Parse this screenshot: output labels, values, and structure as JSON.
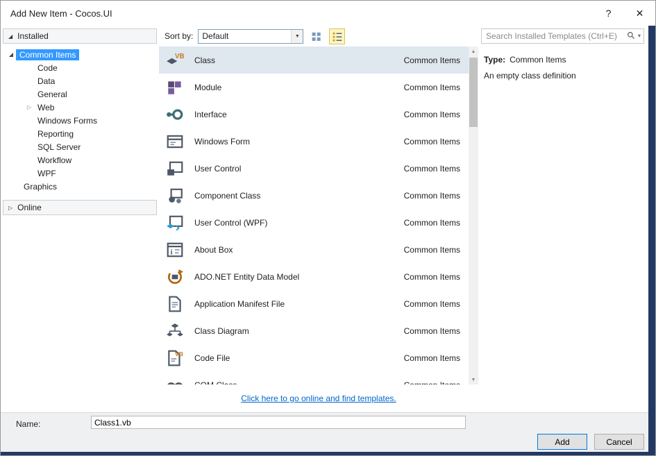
{
  "titlebar": {
    "title": "Add New Item - Cocos.UI",
    "help": "?",
    "close": "✕"
  },
  "icons": {
    "expanded": "◢",
    "collapsed": "▷",
    "combo_arrow": "▼",
    "scroll_up": "▲",
    "scroll_down": "▼",
    "search_caret": "▾"
  },
  "sidebar": {
    "installed_header": "Installed",
    "online_header": "Online",
    "tree": [
      {
        "label": "Common Items",
        "selected": true
      },
      {
        "label": "Code"
      },
      {
        "label": "Data"
      },
      {
        "label": "General"
      },
      {
        "label": "Web"
      },
      {
        "label": "Windows Forms"
      },
      {
        "label": "Reporting"
      },
      {
        "label": "SQL Server"
      },
      {
        "label": "Workflow"
      },
      {
        "label": "WPF"
      },
      {
        "label": "Graphics"
      }
    ]
  },
  "toolbar": {
    "sort_label": "Sort by:",
    "sort_value": "Default"
  },
  "search": {
    "placeholder": "Search Installed Templates (Ctrl+E)"
  },
  "templates": {
    "items": [
      {
        "name": "Class",
        "category": "Common Items",
        "selected": true
      },
      {
        "name": "Module",
        "category": "Common Items"
      },
      {
        "name": "Interface",
        "category": "Common Items"
      },
      {
        "name": "Windows Form",
        "category": "Common Items"
      },
      {
        "name": "User Control",
        "category": "Common Items"
      },
      {
        "name": "Component Class",
        "category": "Common Items"
      },
      {
        "name": "User Control (WPF)",
        "category": "Common Items"
      },
      {
        "name": "About Box",
        "category": "Common Items"
      },
      {
        "name": "ADO.NET Entity Data Model",
        "category": "Common Items"
      },
      {
        "name": "Application Manifest File",
        "category": "Common Items"
      },
      {
        "name": "Class Diagram",
        "category": "Common Items"
      },
      {
        "name": "Code File",
        "category": "Common Items"
      },
      {
        "name": "COM Class",
        "category": "Common Items"
      }
    ],
    "online_link": "Click here to go online and find templates."
  },
  "details": {
    "type_label": "Type:",
    "type_value": "Common Items",
    "description": "An empty class definition"
  },
  "footer": {
    "name_label": "Name:",
    "name_value": "Class1.vb",
    "add_label": "Add",
    "cancel_label": "Cancel"
  },
  "colors": {
    "selection_blue": "#3399ff",
    "list_selection": "#dfe7ef",
    "edge_navy": "#223a63",
    "link_blue": "#0066cc",
    "toggle_button_bg": "#fdf6c2",
    "toggle_button_border": "#e0c060"
  }
}
